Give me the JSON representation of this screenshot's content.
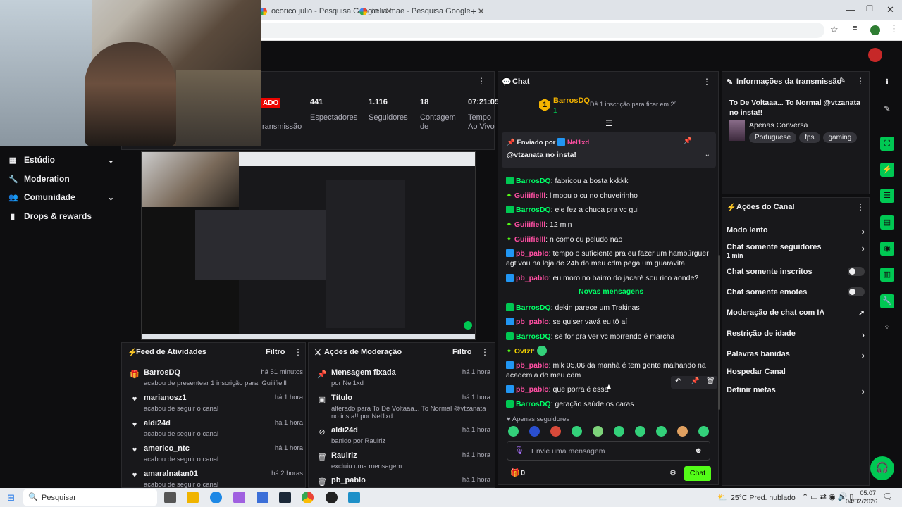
{
  "browser": {
    "tabs": [
      {
        "title": "ocorico julio - Pesquisa Google"
      },
      {
        "title": "celia mae - Pesquisa Google"
      }
    ],
    "new_tab": "+"
  },
  "nav": {
    "items": [
      {
        "label": "Estúdio",
        "icon": "video-icon",
        "chevron": true
      },
      {
        "label": "Moderation",
        "icon": "wrench-icon",
        "chevron": false
      },
      {
        "label": "Comunidade",
        "icon": "users-icon",
        "chevron": true
      },
      {
        "label": "Drops & rewards",
        "icon": "chart-icon",
        "chevron": false
      }
    ]
  },
  "stream_stats": {
    "live_badge": "ADO",
    "items": [
      {
        "value": "",
        "label": "ransmissão"
      },
      {
        "value": "441",
        "label": "Espectadores"
      },
      {
        "value": "1.116",
        "label": "Seguidores"
      },
      {
        "value": "18",
        "label": "Contagem de"
      },
      {
        "value": "07:21:05",
        "label": "Tempo Ao Vivo"
      }
    ]
  },
  "activity_feed": {
    "title": "Feed de Atividades",
    "filter": "Filtro",
    "items": [
      {
        "name": "BarrosDQ",
        "time": "há 51 minutos",
        "sub": "acabou de presentear 1 inscrição para: Guiiifielll",
        "icon": "gift-icon"
      },
      {
        "name": "marianosz1",
        "time": "há 1 hora",
        "sub": "acabou de seguir o canal",
        "icon": "heart-icon"
      },
      {
        "name": "aldi24d",
        "time": "há 1 hora",
        "sub": "acabou de seguir o canal",
        "icon": "heart-icon"
      },
      {
        "name": "americo_ntc",
        "time": "há 1 hora",
        "sub": "acabou de seguir o canal",
        "icon": "heart-icon"
      },
      {
        "name": "amaralnatan01",
        "time": "há 2 horas",
        "sub": "acabou de seguir o canal",
        "icon": "heart-icon"
      }
    ]
  },
  "mod_actions": {
    "title": "Ações de Moderação",
    "filter": "Filtro",
    "items": [
      {
        "name": "Mensagem fixada",
        "time": "há 1 hora",
        "sub": "por Nel1xd",
        "icon": "pin-icon"
      },
      {
        "name": "Título",
        "time": "há 1 hora",
        "sub": "alterado para To De Voltaaa... To Normal @vtzanata no insta!! por Nel1xd",
        "icon": "title-icon"
      },
      {
        "name": "aldi24d",
        "time": "há 1 hora",
        "sub": "banido por Raulrlz",
        "icon": "ban-icon"
      },
      {
        "name": "Raulrlz",
        "time": "há 1 hora",
        "sub": "excluiu uma mensagem",
        "icon": "trash-icon"
      },
      {
        "name": "pb_pablo",
        "time": "há 1 hora",
        "sub": "",
        "icon": "trash-icon"
      }
    ]
  },
  "chat": {
    "title": "Chat",
    "top_gifter": {
      "rank": "1",
      "name": "BarrosDQ",
      "count": "1"
    },
    "goal_text": "Dê 1 inscrição para ficar em 2º",
    "pinned": {
      "label": "Enviado por",
      "by": "Nel1xd",
      "text": "@vtzanata no insta!"
    },
    "messages": [
      {
        "user": "Guiiifielll",
        "color": "pink",
        "badge": "diamond",
        "text": "limpou o cu no chuveirinho"
      },
      {
        "user": "BarrosDQ",
        "color": "green",
        "badge": "gift",
        "text": "ele fez a chuca pra vc gui"
      },
      {
        "user": "Guiiifielll",
        "color": "pink",
        "badge": "diamond",
        "text": "12 min"
      },
      {
        "user": "Guiiifielll",
        "color": "pink",
        "badge": "diamond",
        "text": "n como cu peludo nao"
      },
      {
        "user": "pb_pablo",
        "color": "pink",
        "badge": "blue",
        "text": "tempo o suficiente pra eu fazer um hambúrguer agt vou na loja de 24h do meu cdm pega um guaravita"
      },
      {
        "user": "pb_pablo",
        "color": "pink",
        "badge": "blue",
        "text": "eu moro no bairro do jacaré sou rico aonde?"
      }
    ],
    "first_message": {
      "user": "BarrosDQ",
      "text": "fabricou a bosta kkkkk"
    },
    "new_messages_label": "Novas mensagens",
    "new_messages": [
      {
        "user": "BarrosDQ",
        "color": "green",
        "badge": "gift",
        "text": "dekin parece um Trakinas"
      },
      {
        "user": "pb_pablo",
        "color": "pink",
        "badge": "blue",
        "text": "se quiser vavá eu tô aí"
      },
      {
        "user": "BarrosDQ",
        "color": "green",
        "badge": "gift",
        "text": "se for pra ver vc morrendo é marcha"
      },
      {
        "user": "Ovtzt",
        "color": "yellow",
        "badge": "diamond",
        "text": ""
      },
      {
        "user": "pb_pablo",
        "color": "pink",
        "badge": "blue",
        "text": "mlk 05,06 da manhã é tem gente malhando na academia do meu cdm"
      },
      {
        "user": "pb_pablo",
        "color": "pink",
        "badge": "blue",
        "text": "que porra é essa"
      },
      {
        "user": "BarrosDQ",
        "color": "green",
        "badge": "gift",
        "text": "geração saúde os caras"
      }
    ],
    "followers_only": "Apenas seguidores",
    "input_placeholder": "Envie uma mensagem",
    "points": "0",
    "send": "Chat"
  },
  "stream_info": {
    "title": "Informações da transmissão",
    "stream_title": "To De Voltaaa... To Normal @vtzanata no insta!!",
    "category": "Apenas Conversa",
    "tags": [
      "Portuguese",
      "fps",
      "gaming"
    ]
  },
  "channel_actions": {
    "title": "Ações do Canal",
    "items": [
      {
        "label": "Modo lento",
        "control": "chevron",
        "sub": ""
      },
      {
        "label": "Chat somente seguidores",
        "control": "chevron",
        "sub": "1 min"
      },
      {
        "label": "Chat somente inscritos",
        "control": "toggle",
        "sub": ""
      },
      {
        "label": "Chat somente emotes",
        "control": "toggle",
        "sub": ""
      },
      {
        "label": "Moderação de chat com IA",
        "control": "external",
        "sub": ""
      },
      {
        "label": "Restrição de idade",
        "control": "chevron",
        "sub": ""
      },
      {
        "label": "Palavras banidas",
        "control": "chevron",
        "sub": ""
      },
      {
        "label": "Hospedar Canal",
        "control": "none",
        "sub": ""
      },
      {
        "label": "Definir metas",
        "control": "chevron",
        "sub": ""
      }
    ]
  },
  "taskbar": {
    "search": "Pesquisar",
    "weather": "25°C  Pred. nublado",
    "time": "05:07",
    "date": "04/02/2026"
  },
  "colors": {
    "accent": "#53fc18",
    "panel": "#18181b",
    "background": "#0e0e10"
  }
}
